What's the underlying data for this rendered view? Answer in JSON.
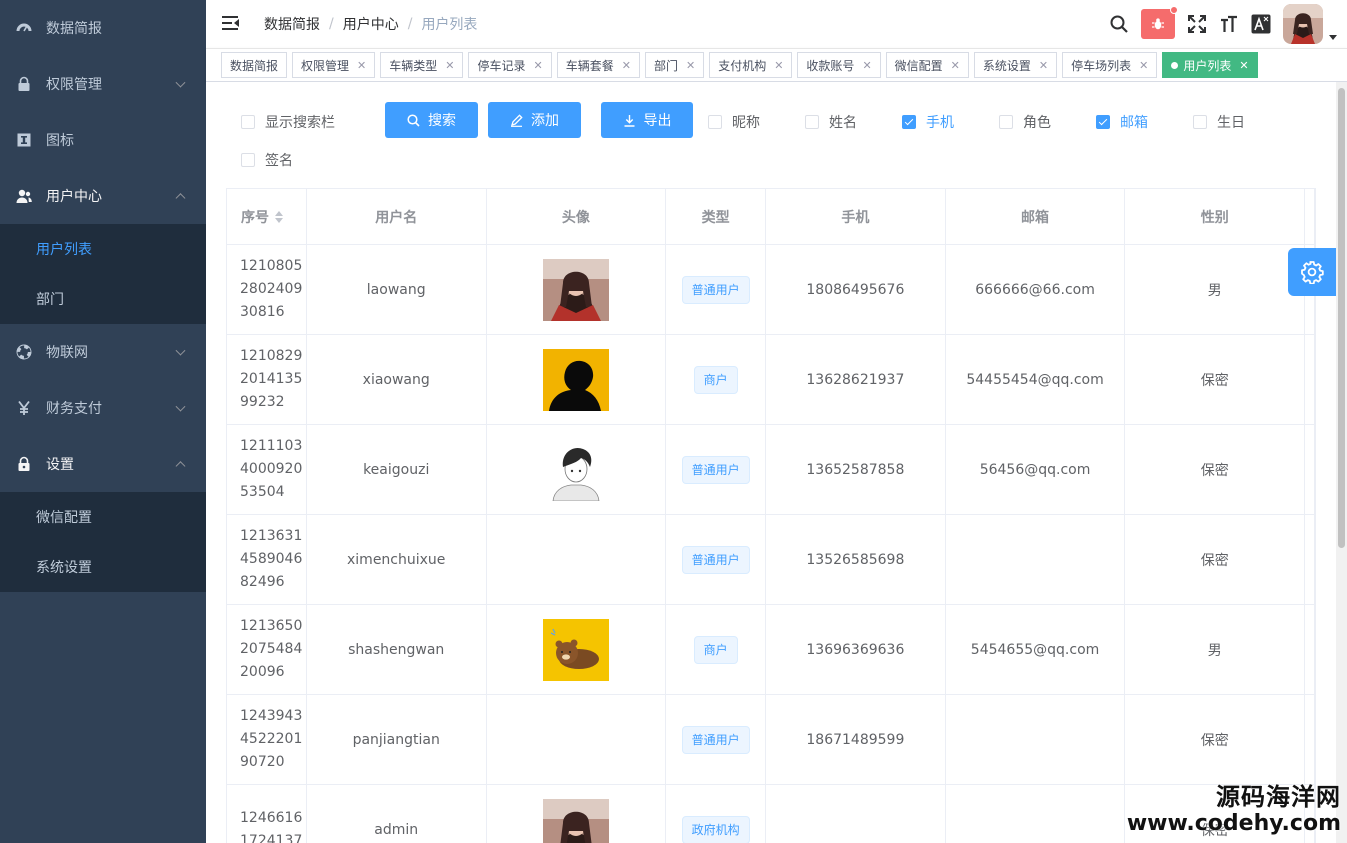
{
  "sidebar": {
    "items": [
      {
        "label": "数据简报",
        "icon": "dashboard-icon"
      },
      {
        "label": "权限管理",
        "icon": "lock-icon"
      },
      {
        "label": "图标",
        "icon": "icon-font-icon"
      },
      {
        "label": "用户中心",
        "icon": "user-icon",
        "open": true
      },
      {
        "label": "物联网",
        "icon": "lifebuoy-icon"
      },
      {
        "label": "财务支付",
        "icon": "yen-icon"
      },
      {
        "label": "设置",
        "icon": "lock-icon",
        "open": true
      }
    ],
    "user_center_sub": [
      {
        "label": "用户列表",
        "active": true
      },
      {
        "label": "部门"
      }
    ],
    "settings_sub": [
      {
        "label": "微信配置"
      },
      {
        "label": "系统设置"
      }
    ]
  },
  "breadcrumb": [
    "数据简报",
    "用户中心",
    "用户列表"
  ],
  "tags": [
    "数据简报",
    "权限管理",
    "车辆类型",
    "停车记录",
    "车辆套餐",
    "部门",
    "支付机构",
    "收款账号",
    "微信配置",
    "系统设置",
    "停车场列表",
    "用户列表"
  ],
  "active_tag": "用户列表",
  "toolbar": {
    "show_search": "显示搜索栏",
    "search_btn": "搜索",
    "add_btn": "添加",
    "export_btn": "导出",
    "columns": [
      {
        "label": "昵称",
        "checked": false
      },
      {
        "label": "姓名",
        "checked": false
      },
      {
        "label": "手机",
        "checked": true
      },
      {
        "label": "角色",
        "checked": false
      },
      {
        "label": "邮箱",
        "checked": true
      },
      {
        "label": "生日",
        "checked": false
      }
    ],
    "signature": "签名"
  },
  "table": {
    "headers": [
      "序号",
      "用户名",
      "头像",
      "类型",
      "手机",
      "邮箱",
      "性别"
    ],
    "rows": [
      {
        "id": [
          "1210805",
          "2802409",
          "30816"
        ],
        "username": "laowang",
        "avatar": "portrait-woman",
        "type": "普通用户",
        "phone": "18086495676",
        "email": "666666@66.com",
        "gender": "男"
      },
      {
        "id": [
          "1210829",
          "2014135",
          "99232"
        ],
        "username": "xiaowang",
        "avatar": "silhouette-yellow",
        "type": "商户",
        "phone": "13628621937",
        "email": "54455454@qq.com",
        "gender": "保密"
      },
      {
        "id": [
          "1211103",
          "4000920",
          "53504"
        ],
        "username": "keaigouzi",
        "avatar": "sketch-boy",
        "type": "普通用户",
        "phone": "13652587858",
        "email": "56456@qq.com",
        "gender": "保密"
      },
      {
        "id": [
          "1213631",
          "4589046",
          "82496"
        ],
        "username": "ximenchuixue",
        "avatar": "",
        "type": "普通用户",
        "phone": "13526585698",
        "email": "",
        "gender": "保密"
      },
      {
        "id": [
          "1213650",
          "2075484",
          "20096"
        ],
        "username": "shashengwan",
        "avatar": "bear-yellow",
        "type": "商户",
        "phone": "13696369636",
        "email": "5454655@qq.com",
        "gender": "男"
      },
      {
        "id": [
          "1243943",
          "4522201",
          "90720"
        ],
        "username": "panjiangtian",
        "avatar": "",
        "type": "普通用户",
        "phone": "18671489599",
        "email": "",
        "gender": "保密"
      },
      {
        "id": [
          "1246616",
          "1724137",
          ""
        ],
        "username": "admin",
        "avatar": "portrait-woman",
        "type": "政府机构",
        "phone": "",
        "email": "",
        "gender": "保密"
      }
    ]
  },
  "watermark": {
    "line1": "源码海洋网",
    "line2": "www.codehy.com"
  },
  "colors": {
    "sidebar_bg": "#304156",
    "submenu_bg": "#1f2d3d",
    "primary": "#409eff",
    "active_tag": "#42b983",
    "danger": "#f56c6c"
  }
}
